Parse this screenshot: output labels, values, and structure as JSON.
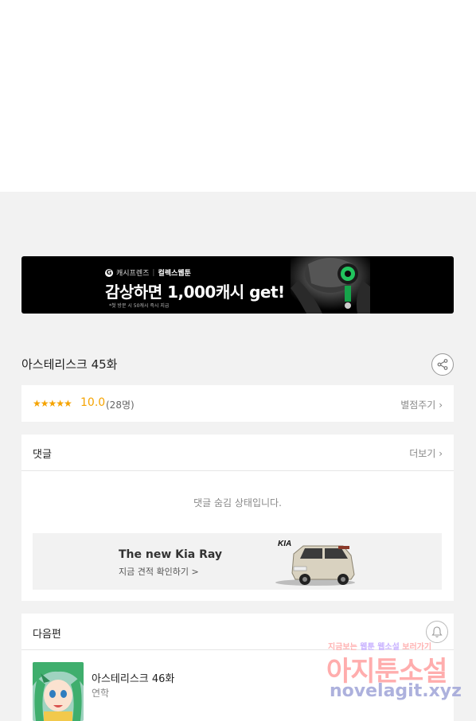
{
  "banner": {
    "brand_icon": "G",
    "brand_left": "캐시프렌즈",
    "brand_right": "컬렉스웹툰",
    "headline": "감상하면 1,000캐시 get!",
    "fine_print": "*첫 방문 시 50캐시 즉시 지급"
  },
  "episode": {
    "title": "아스테리스크 45화"
  },
  "rating": {
    "stars": "★★★★★",
    "score": "10.0",
    "count": "(28명)",
    "rate_button": "별점주기"
  },
  "comments": {
    "label": "댓글",
    "more": "더보기",
    "hidden_message": "댓글 숨김 상태입니다."
  },
  "ad": {
    "title": "The new Kia Ray",
    "subtitle": "지금 견적 확인하기 >",
    "brand": "KIA"
  },
  "next": {
    "label": "다음편",
    "item_title": "아스테리스크 46화",
    "item_status": "연학"
  },
  "watermark": {
    "line1a": "지금보는",
    "line1b": "웹툰",
    "line1c": "웹소설",
    "line1d": "보러가기",
    "main": "아지툰소설",
    "url": "novelagit.xyz"
  },
  "colors": {
    "star": "#f5a300",
    "banner_bg": "#000000",
    "page_gray": "#f2f2f2"
  }
}
